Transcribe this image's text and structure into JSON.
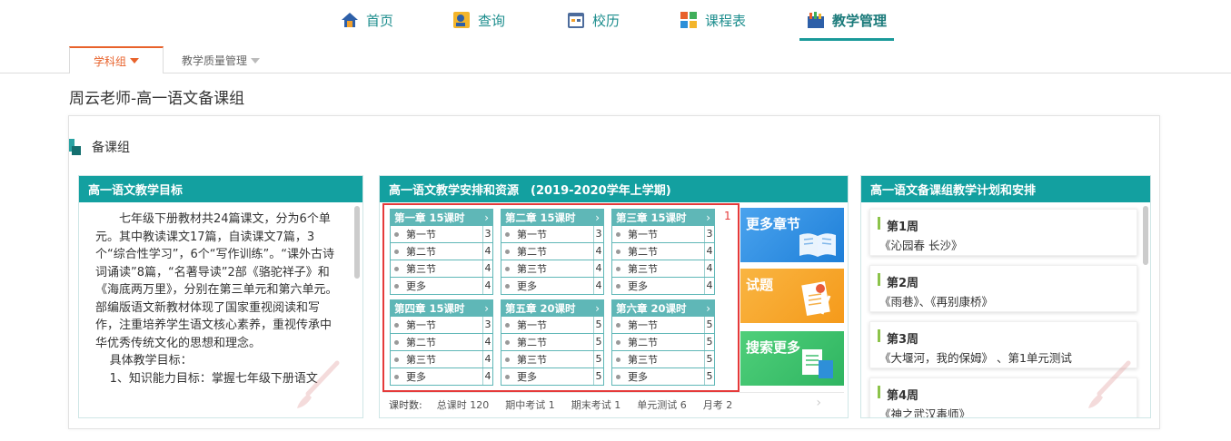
{
  "nav": {
    "items": [
      {
        "label": "首页",
        "icon": "home-icon"
      },
      {
        "label": "查询",
        "icon": "search-person-icon"
      },
      {
        "label": "校历",
        "icon": "calendar-icon"
      },
      {
        "label": "课程表",
        "icon": "timetable-icon"
      },
      {
        "label": "教学管理",
        "icon": "teaching-icon",
        "active": true
      }
    ]
  },
  "subtabs": {
    "tab1": "学科组",
    "tab2": "教学质量管理"
  },
  "page_title": "周云老师-高一语文备课组",
  "section_title": "备课组",
  "goals": {
    "title": "高一语文教学目标",
    "p1": "七年级下册教材共24篇课文，分为6个单元。其中教读课文17篇，自读课文7篇，3个“综合性学习”，6个“写作训练”。“课外古诗词诵读”8篇，“名著导读”2部《骆驼祥子》和《海底两万里》，分别在第三单元和第六单元。部编版语文新教材体现了国家重视阅读和写作，注重培养学生语文核心素养，重视传承中华优秀传统文化的思想和理念。",
    "p2": "具体教学目标：",
    "p3": "1、知识能力目标：掌握七年级下册语文"
  },
  "arrange": {
    "title": "高一语文教学安排和资源　(2019-2020学年上学期)",
    "badge": "1",
    "chapters": [
      {
        "title": "第一章  15课时",
        "sections": [
          {
            "name": "第一节",
            "count": "3"
          },
          {
            "name": "第二节",
            "count": "4"
          },
          {
            "name": "第三节",
            "count": "4"
          },
          {
            "name": "更多",
            "count": "4"
          }
        ]
      },
      {
        "title": "第二章  15课时",
        "sections": [
          {
            "name": "第一节",
            "count": "3"
          },
          {
            "name": "第二节",
            "count": "4"
          },
          {
            "name": "第三节",
            "count": "4"
          },
          {
            "name": "更多",
            "count": "4"
          }
        ]
      },
      {
        "title": "第三章  15课时",
        "sections": [
          {
            "name": "第一节",
            "count": "3"
          },
          {
            "name": "第二节",
            "count": "4"
          },
          {
            "name": "第三节",
            "count": "4"
          },
          {
            "name": "更多",
            "count": "4"
          }
        ]
      },
      {
        "title": "第四章  15课时",
        "sections": [
          {
            "name": "第一节",
            "count": "3"
          },
          {
            "name": "第二节",
            "count": "4"
          },
          {
            "name": "第三节",
            "count": "4"
          },
          {
            "name": "更多",
            "count": "4"
          }
        ]
      },
      {
        "title": "第五章  20课时",
        "sections": [
          {
            "name": "第一节",
            "count": "5"
          },
          {
            "name": "第二节",
            "count": "5"
          },
          {
            "name": "第三节",
            "count": "5"
          },
          {
            "name": "更多",
            "count": "5"
          }
        ]
      },
      {
        "title": "第六章  20课时",
        "sections": [
          {
            "name": "第一节",
            "count": "5"
          },
          {
            "name": "第二节",
            "count": "5"
          },
          {
            "name": "第三节",
            "count": "5"
          },
          {
            "name": "更多",
            "count": "5"
          }
        ]
      }
    ],
    "promos": {
      "more_chapters": "更多章节",
      "exams": "试题",
      "search_more": "搜索更多"
    },
    "stats": {
      "label": "课时数:",
      "total": "总课时 120",
      "midterm": "期中考试 1",
      "final": "期末考试 1",
      "unit_test": "单元测试 6",
      "monthly": "月考 2"
    }
  },
  "plan": {
    "title": "高一语文备课组教学计划和安排",
    "weeks": [
      {
        "label": "第1周",
        "content": "《沁园春 长沙》"
      },
      {
        "label": "第2周",
        "content": "《雨巷》、《再别康桥》"
      },
      {
        "label": "第3周",
        "content": "《大堰河，我的保姆》 、第1单元测试"
      },
      {
        "label": "第4周",
        "content": "《神之武汉毒师》"
      }
    ]
  },
  "colors": {
    "teal": "#13a0a0",
    "orange": "#e8622b",
    "red": "#e53a3a",
    "chapter": "#5fb7b7"
  }
}
